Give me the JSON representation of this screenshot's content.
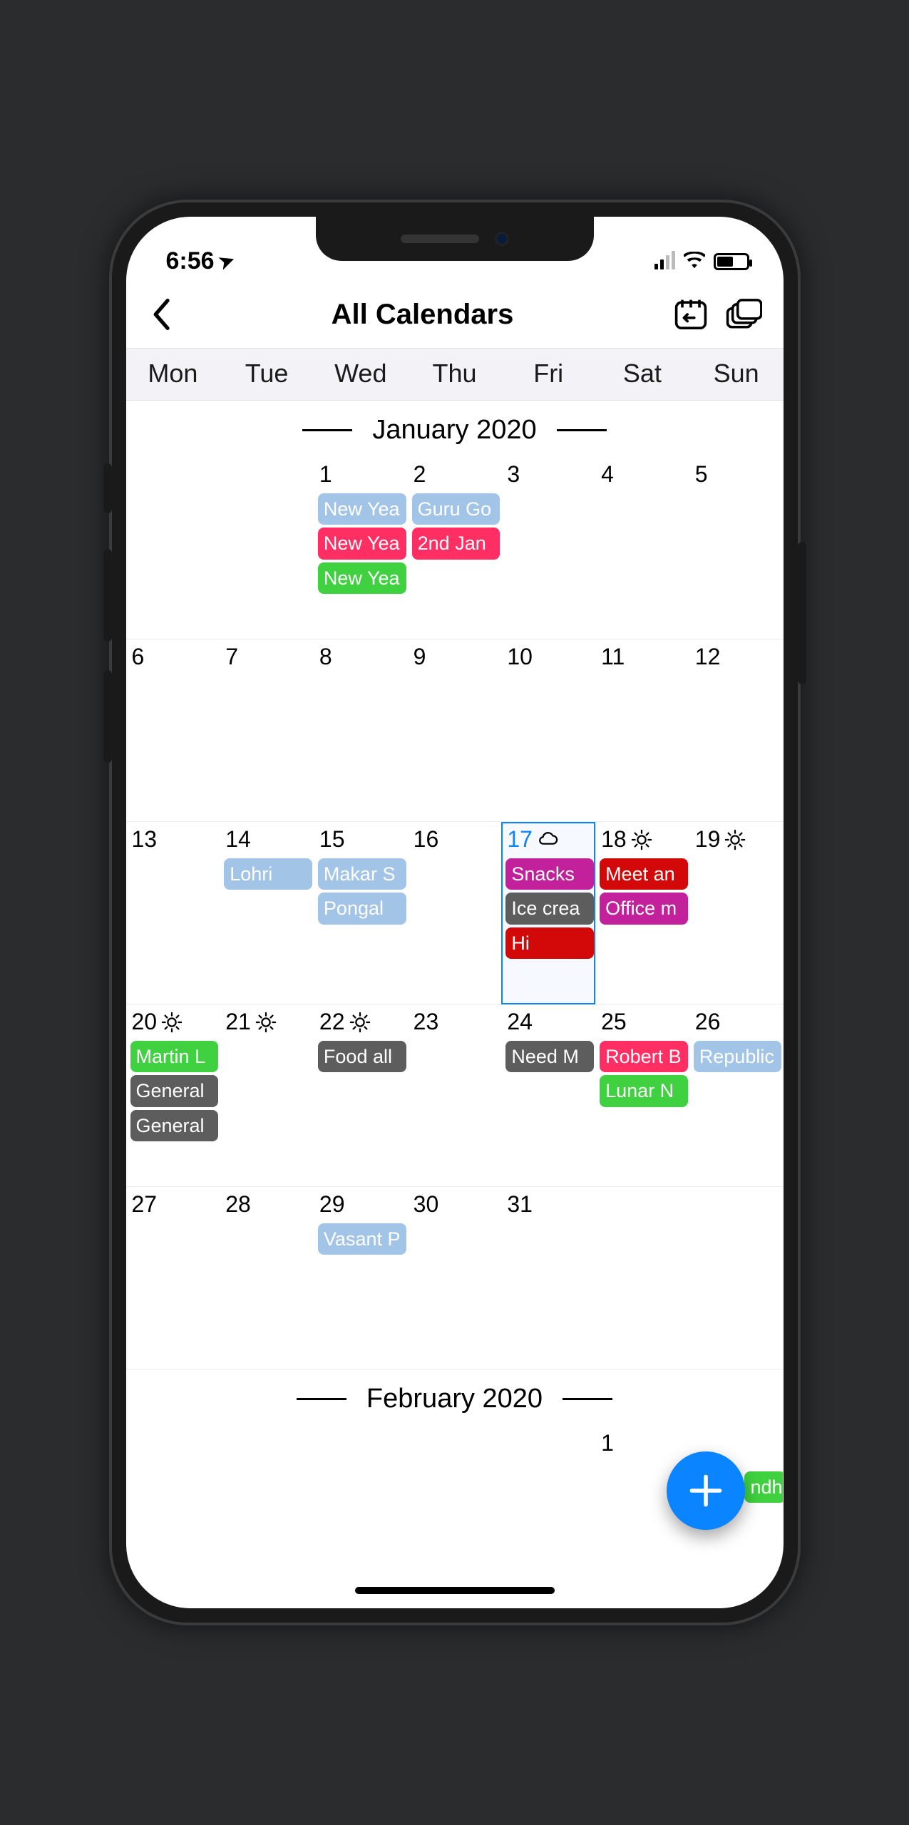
{
  "status": {
    "time": "6:56",
    "location_arrow": "➤"
  },
  "header": {
    "title": "All Calendars"
  },
  "weekdays": [
    "Mon",
    "Tue",
    "Wed",
    "Thu",
    "Fri",
    "Sat",
    "Sun"
  ],
  "months": {
    "january": {
      "label": "January 2020",
      "days": {
        "d1": {
          "num": "1",
          "events": [
            {
              "t": "New Yea",
              "c": "lightblue"
            },
            {
              "t": "New Yea",
              "c": "pink"
            },
            {
              "t": "New Yea",
              "c": "green"
            }
          ]
        },
        "d2": {
          "num": "2",
          "events": [
            {
              "t": "Guru Go",
              "c": "lightblue"
            },
            {
              "t": "2nd Jan",
              "c": "pink"
            }
          ]
        },
        "d3": {
          "num": "3"
        },
        "d4": {
          "num": "4"
        },
        "d5": {
          "num": "5"
        },
        "d6": {
          "num": "6"
        },
        "d7": {
          "num": "7"
        },
        "d8": {
          "num": "8"
        },
        "d9": {
          "num": "9"
        },
        "d10": {
          "num": "10"
        },
        "d11": {
          "num": "11"
        },
        "d12": {
          "num": "12"
        },
        "d13": {
          "num": "13"
        },
        "d14": {
          "num": "14",
          "events": [
            {
              "t": "Lohri",
              "c": "lightblue"
            }
          ]
        },
        "d15": {
          "num": "15",
          "events": [
            {
              "t": "Makar S",
              "c": "lightblue"
            },
            {
              "t": "Pongal",
              "c": "lightblue"
            }
          ]
        },
        "d16": {
          "num": "16"
        },
        "d17": {
          "num": "17",
          "today": true,
          "weather": "cloud",
          "events": [
            {
              "t": "Snacks",
              "c": "magenta"
            },
            {
              "t": "Ice crea",
              "c": "grey"
            },
            {
              "t": "Hi",
              "c": "red"
            }
          ]
        },
        "d18": {
          "num": "18",
          "weather": "sun",
          "events": [
            {
              "t": "Meet an",
              "c": "red"
            },
            {
              "t": "Office m",
              "c": "magenta"
            }
          ]
        },
        "d19": {
          "num": "19",
          "weather": "sun"
        },
        "d20": {
          "num": "20",
          "weather": "sun",
          "events": [
            {
              "t": "Martin L",
              "c": "green"
            },
            {
              "t": "General",
              "c": "grey"
            },
            {
              "t": "General",
              "c": "grey"
            }
          ]
        },
        "d21": {
          "num": "21",
          "weather": "sun"
        },
        "d22": {
          "num": "22",
          "weather": "sun",
          "events": [
            {
              "t": "Food all",
              "c": "grey"
            }
          ]
        },
        "d23": {
          "num": "23"
        },
        "d24": {
          "num": "24",
          "events": [
            {
              "t": "Need M",
              "c": "grey"
            }
          ]
        },
        "d25": {
          "num": "25",
          "events": [
            {
              "t": "Robert B",
              "c": "pink"
            },
            {
              "t": "Lunar N",
              "c": "green"
            }
          ]
        },
        "d26": {
          "num": "26",
          "events": [
            {
              "t": "Republic",
              "c": "lightblue"
            }
          ]
        },
        "d27": {
          "num": "27"
        },
        "d28": {
          "num": "28"
        },
        "d29": {
          "num": "29",
          "events": [
            {
              "t": "Vasant P",
              "c": "lightblue"
            }
          ]
        },
        "d30": {
          "num": "30"
        },
        "d31": {
          "num": "31"
        }
      }
    },
    "february": {
      "label": "February 2020",
      "days": {
        "d1": {
          "num": "1",
          "events": [
            {
              "t": "ndh",
              "c": "green"
            }
          ]
        }
      }
    }
  }
}
